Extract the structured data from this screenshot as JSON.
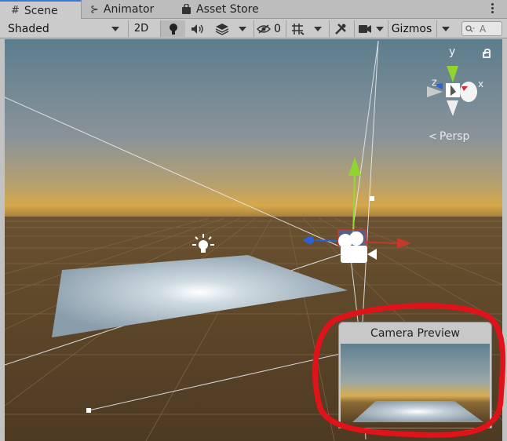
{
  "tabs": [
    {
      "label": "Scene",
      "icon": "grid-icon"
    },
    {
      "label": "Animator",
      "icon": "animator-icon"
    },
    {
      "label": "Asset Store",
      "icon": "shopping-bag-icon"
    }
  ],
  "toolbar": {
    "draw_mode": "Shaded",
    "mode_2d": "2D",
    "hidden_count": "0",
    "gizmos": "Gizmos",
    "search_placeholder": "A"
  },
  "viewport": {
    "projection": "Persp",
    "axes": {
      "x": "x",
      "y": "y",
      "z": "z"
    }
  },
  "camera_preview": {
    "title": "Camera Preview"
  },
  "colors": {
    "accent": "#3a79d7",
    "annotation_red": "#e0131a",
    "ground": "#5a4224",
    "sky_top": "#5f7f8e"
  }
}
